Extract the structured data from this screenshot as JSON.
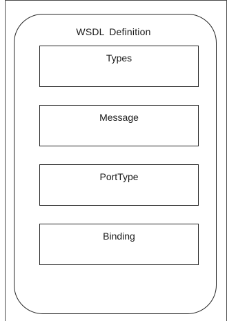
{
  "diagram": {
    "title": "WSDL  Definition",
    "elements": [
      {
        "label": "Types"
      },
      {
        "label": "Message"
      },
      {
        "label": "PortType"
      },
      {
        "label": "Binding"
      }
    ]
  }
}
